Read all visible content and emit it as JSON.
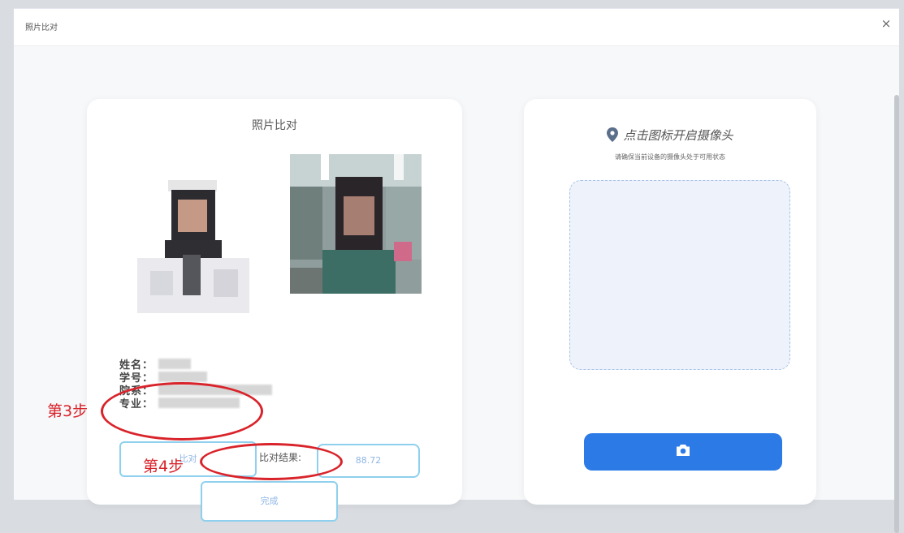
{
  "dialog": {
    "title": "照片比对",
    "close_label": "×"
  },
  "compare": {
    "title": "照片比对",
    "info": [
      {
        "label": "姓名："
      },
      {
        "label": "学号："
      },
      {
        "label": "院系："
      },
      {
        "label": "专业："
      }
    ],
    "compare_button_label": "比对",
    "result_label": "比对结果:",
    "result_value": "88.72",
    "finish_button_label": "完成"
  },
  "annotations": {
    "step3": "第3步",
    "step4": "第4步",
    "color": "#d9232a"
  },
  "camera": {
    "heading": "点击图标开启摄像头",
    "subtext": "请确保当前设备的摄像头处于可用状态",
    "pin_icon": "location-pin-icon",
    "camera_icon": "camera-icon",
    "button_color": "#2b7ae6"
  }
}
